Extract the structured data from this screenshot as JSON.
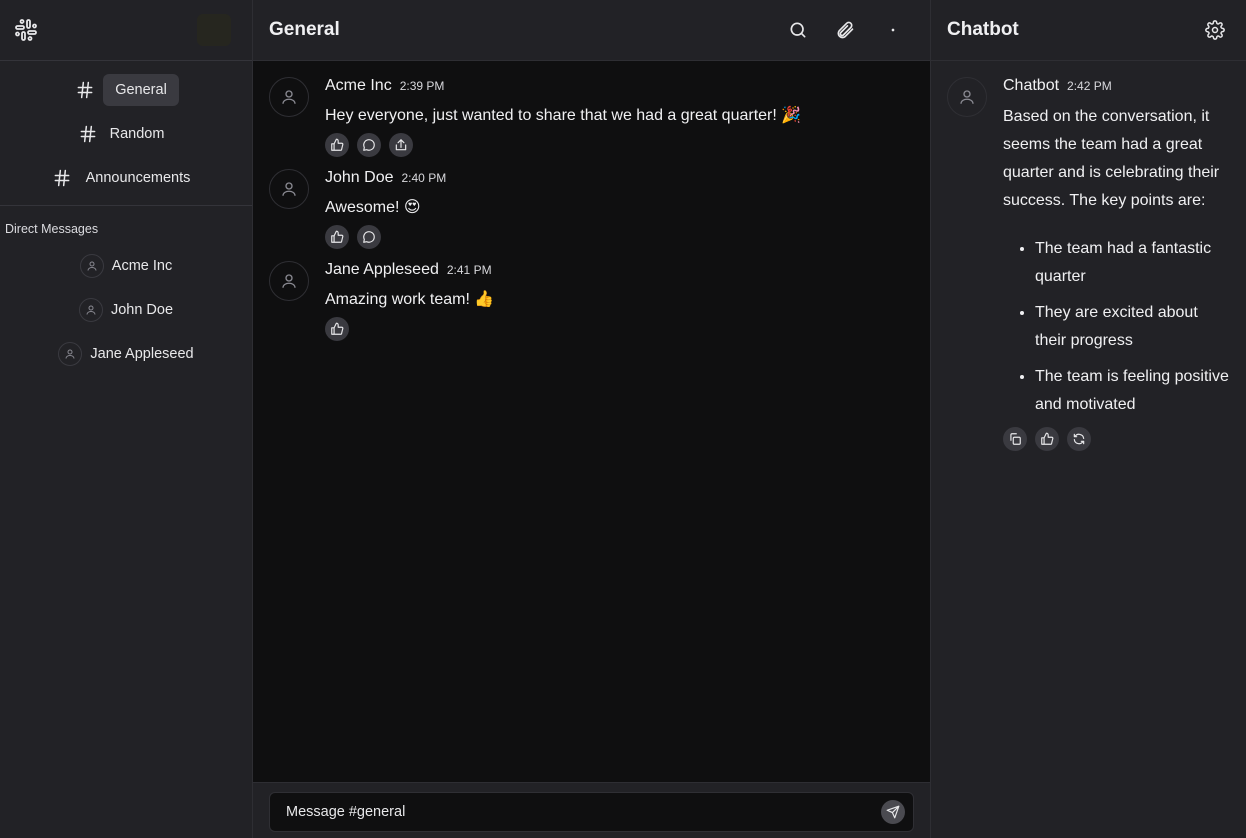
{
  "sidebar": {
    "channels": [
      {
        "label": "General",
        "active": true
      },
      {
        "label": "Random",
        "active": false
      },
      {
        "label": "Announcements",
        "active": false
      }
    ],
    "dm_title": "Direct Messages",
    "dms": [
      {
        "name": "Acme Inc"
      },
      {
        "name": "John Doe"
      },
      {
        "name": "Jane Appleseed"
      }
    ]
  },
  "main": {
    "title": "General",
    "messages": [
      {
        "author": "Acme Inc",
        "time": "2:39 PM",
        "text": "Hey everyone, just wanted to share that we had a great quarter! 🎉"
      },
      {
        "author": "John Doe",
        "time": "2:40 PM",
        "text": "Awesome! 😍"
      },
      {
        "author": "Jane Appleseed",
        "time": "2:41 PM",
        "text": "Amazing work team! 👍"
      }
    ],
    "composer_placeholder": "Message #general"
  },
  "chatbot": {
    "title": "Chatbot",
    "message": {
      "author": "Chatbot",
      "time": "2:42 PM",
      "intro": "Based on the conversation, it seems the team had a great quarter and is celebrating their success. The key points are:",
      "points": [
        "The team had a fantastic quarter",
        "They are excited about their progress",
        "The team is feeling positive and motivated"
      ]
    }
  },
  "colors": {
    "panel": "#222226",
    "main_bg": "#0f0f10",
    "active_channel": "#3a3a40",
    "text": "#f0f0f2"
  },
  "icons": [
    "slack-logo-icon",
    "hash-icon",
    "user-icon",
    "search-icon",
    "paperclip-icon",
    "more-dot-icon",
    "gear-icon",
    "thumbs-up-icon",
    "comment-icon",
    "share-icon",
    "copy-icon",
    "refresh-icon",
    "send-icon"
  ]
}
